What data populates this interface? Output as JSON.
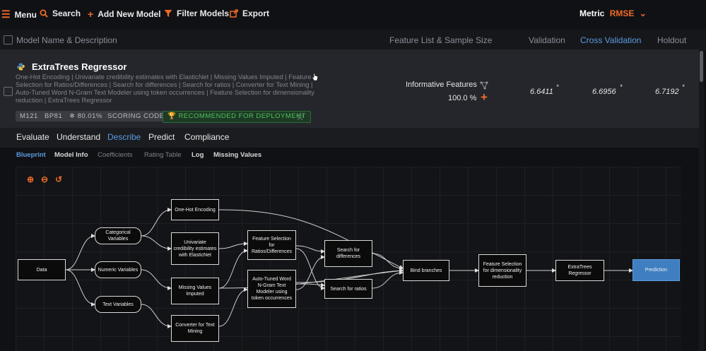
{
  "toolbar": {
    "menu": "Menu",
    "search": "Search",
    "add_model": "Add New Model",
    "filter_models": "Filter Models",
    "export": "Export",
    "metric_label": "Metric",
    "metric_value": "RMSE"
  },
  "columns": {
    "name": "Model Name & Description",
    "feature_list": "Feature List & Sample Size",
    "validation": "Validation",
    "cross_validation": "Cross Validation",
    "holdout": "Holdout"
  },
  "model": {
    "title": "ExtraTrees Regressor",
    "description": "One-Hot Encoding | Univariate credibility estimates with ElasticNet | Missing Values Imputed | Feature Selection for Ratios/Differences | Search for differences | Search for ratios | Converter for Text Mining | Auto-Tuned Word N-Gram Text Modeler using token occurrences | Feature Selection for dimensionality reduction | ExtraTrees Regressor",
    "badges": {
      "id": "M121",
      "bp": "BP81",
      "sample": "❄ 80.01%",
      "scoring": "SCORING CODE",
      "recommended": "RECOMMENDED FOR DEPLOYMENT"
    },
    "feature_list": "Informative Features",
    "sample_size": "100.0 %",
    "validation": "6.6411",
    "cross_validation": "6.6956",
    "holdout": "6.7192",
    "asterisk": "*"
  },
  "tabs": [
    "Evaluate",
    "Understand",
    "Describe",
    "Predict",
    "Compliance"
  ],
  "subtabs": [
    "Blueprint",
    "Model Info",
    "Coefficients",
    "Rating Table",
    "Log",
    "Missing Values"
  ],
  "blueprint": {
    "nodes": {
      "data": "Data",
      "categorical": "Categorical Variables",
      "numeric": "Numeric Variables",
      "text": "Text Variables",
      "onehot": "One-Hot Encoding",
      "univariate": "Univariate credibility estimates with ElasticNet",
      "missing": "Missing Values Imputed",
      "converter": "Converter for Text Mining",
      "fs_ratios": "Feature Selection for Ratios/Differences",
      "autotuned": "Auto-Tuned Word N-Gram Text Modeler using token occurrences",
      "search_diff": "Search for differences",
      "search_ratio": "Search for ratios",
      "bind": "Bind branches",
      "fs_dim": "Feature Selection for dimensionality reduction",
      "extratrees": "ExtraTrees Regressor",
      "prediction": "Prediction"
    }
  },
  "colors": {
    "accent": "#f06a28",
    "link": "#5b9be0",
    "green": "#4fc15e"
  }
}
